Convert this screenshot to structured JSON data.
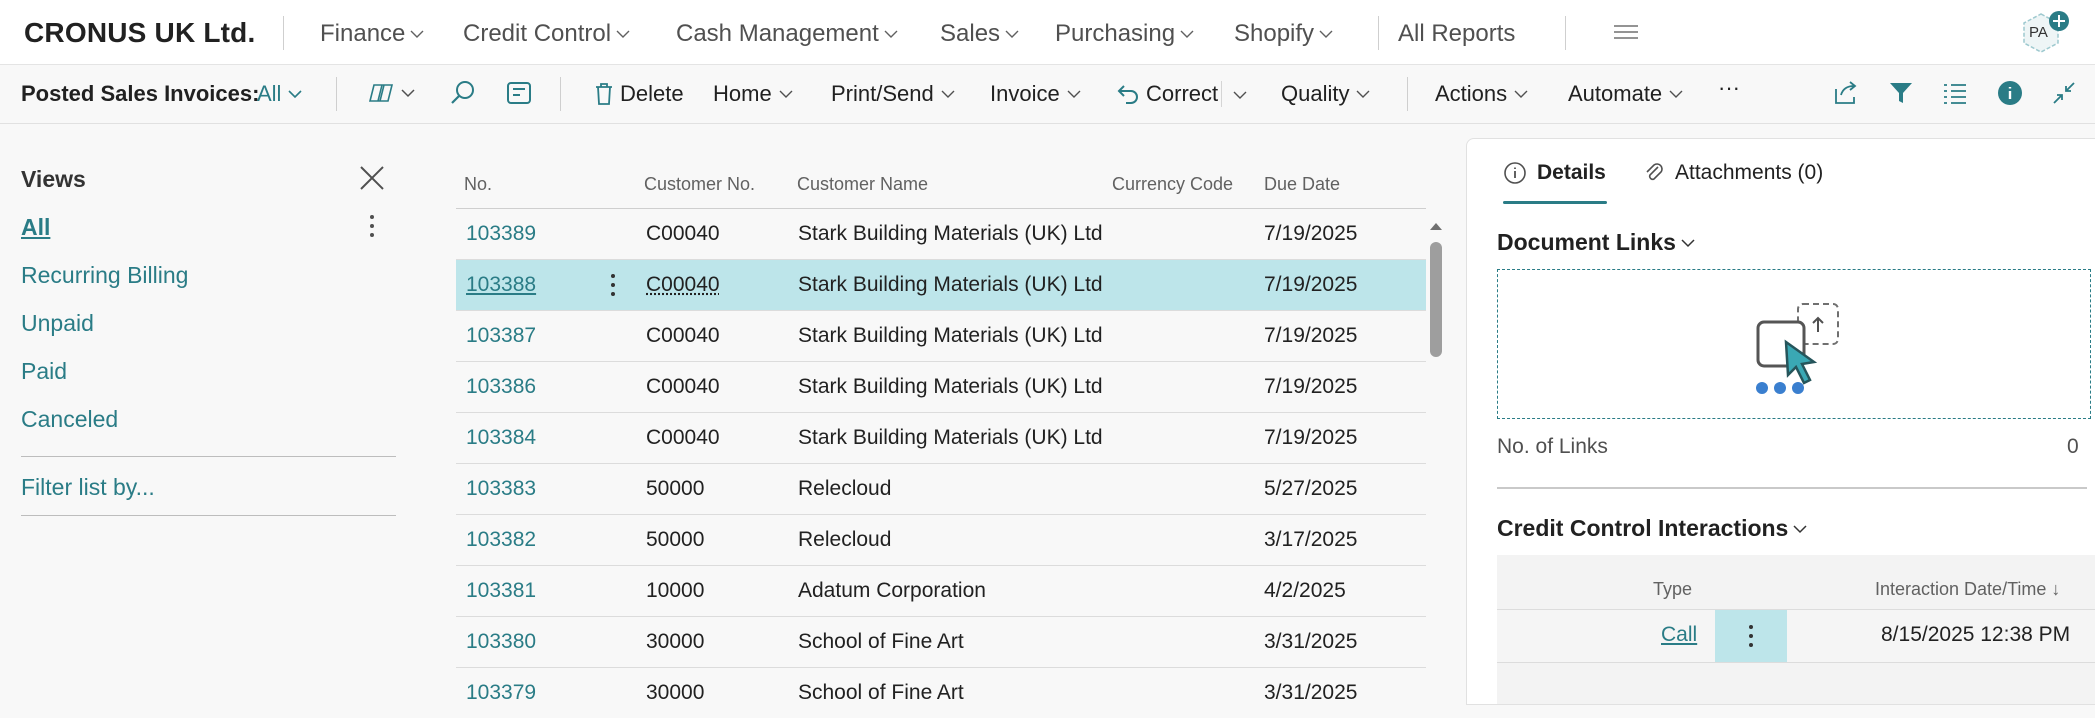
{
  "app": {
    "company": "CRONUS UK Ltd.",
    "nav": [
      "Finance",
      "Credit Control",
      "Cash Management",
      "Sales",
      "Purchasing",
      "Shopify"
    ],
    "all_reports": "All Reports",
    "avatar_initials": "PA"
  },
  "actionbar": {
    "page_title": "Posted Sales Invoices:",
    "view_filter": "All",
    "delete": "Delete",
    "home": "Home",
    "print_send": "Print/Send",
    "invoice": "Invoice",
    "correct": "Correct",
    "quality": "Quality",
    "actions": "Actions",
    "automate": "Automate",
    "more": "···"
  },
  "views": {
    "title": "Views",
    "items": [
      "All",
      "Recurring Billing",
      "Unpaid",
      "Paid",
      "Canceled"
    ],
    "active": "All",
    "filter_link": "Filter list by..."
  },
  "list": {
    "columns": [
      "No.",
      "Customer No.",
      "Customer Name",
      "Currency Code",
      "Due Date"
    ],
    "rows": [
      {
        "no": "103389",
        "customer_no": "C00040",
        "customer_name": "Stark Building Materials (UK) Ltd",
        "currency": "",
        "due": "7/19/2025"
      },
      {
        "no": "103388",
        "customer_no": "C00040",
        "customer_name": "Stark Building Materials (UK) Ltd",
        "currency": "",
        "due": "7/19/2025"
      },
      {
        "no": "103387",
        "customer_no": "C00040",
        "customer_name": "Stark Building Materials (UK) Ltd",
        "currency": "",
        "due": "7/19/2025"
      },
      {
        "no": "103386",
        "customer_no": "C00040",
        "customer_name": "Stark Building Materials (UK) Ltd",
        "currency": "",
        "due": "7/19/2025"
      },
      {
        "no": "103384",
        "customer_no": "C00040",
        "customer_name": "Stark Building Materials (UK) Ltd",
        "currency": "",
        "due": "7/19/2025"
      },
      {
        "no": "103383",
        "customer_no": "50000",
        "customer_name": "Relecloud",
        "currency": "",
        "due": "5/27/2025"
      },
      {
        "no": "103382",
        "customer_no": "50000",
        "customer_name": "Relecloud",
        "currency": "",
        "due": "3/17/2025"
      },
      {
        "no": "103381",
        "customer_no": "10000",
        "customer_name": "Adatum Corporation",
        "currency": "",
        "due": "4/2/2025"
      },
      {
        "no": "103380",
        "customer_no": "30000",
        "customer_name": "School of Fine Art",
        "currency": "",
        "due": "3/31/2025"
      },
      {
        "no": "103379",
        "customer_no": "30000",
        "customer_name": "School of Fine Art",
        "currency": "",
        "due": "3/31/2025"
      }
    ],
    "selected_no": "103388"
  },
  "factbox": {
    "tabs": [
      "Details",
      "Attachments (0)"
    ],
    "active_tab": "Details",
    "document_links": {
      "title": "Document Links",
      "count_label": "No. of Links",
      "count": "0"
    },
    "credit_control": {
      "title": "Credit Control Interactions",
      "columns": [
        "Type",
        "Interaction Date/Time ↓"
      ],
      "rows": [
        {
          "type": "Call",
          "datetime": "8/15/2025 12:38 PM"
        }
      ]
    }
  },
  "colors": {
    "accent": "#2a7c86",
    "selected_row": "#bde5ea",
    "text": "#212121"
  }
}
